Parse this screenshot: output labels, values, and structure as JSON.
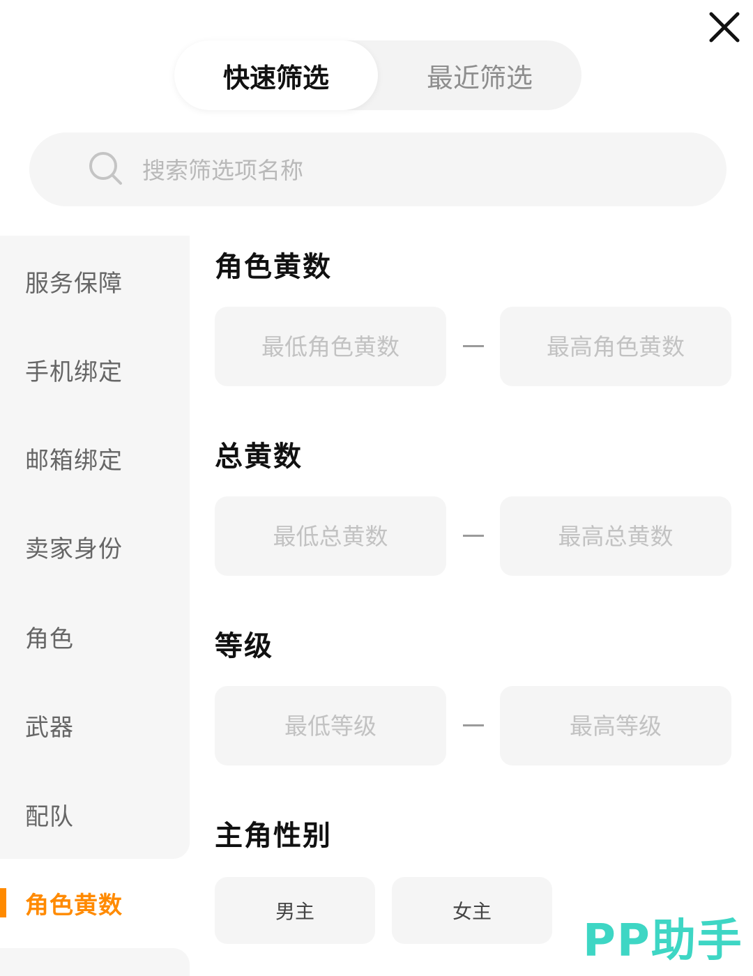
{
  "tabs": {
    "quick": "快速筛选",
    "recent": "最近筛选"
  },
  "search": {
    "placeholder": "搜索筛选项名称"
  },
  "sidebar": {
    "items": [
      {
        "label": "服务保障"
      },
      {
        "label": "手机绑定"
      },
      {
        "label": "邮箱绑定"
      },
      {
        "label": "卖家身份"
      },
      {
        "label": "角色"
      },
      {
        "label": "武器"
      },
      {
        "label": "配队"
      },
      {
        "label": "角色黄数"
      }
    ],
    "active_index": 7
  },
  "sections": {
    "role_yellow": {
      "title": "角色黄数",
      "min_placeholder": "最低角色黄数",
      "max_placeholder": "最高角色黄数"
    },
    "total_yellow": {
      "title": "总黄数",
      "min_placeholder": "最低总黄数",
      "max_placeholder": "最高总黄数"
    },
    "level": {
      "title": "等级",
      "min_placeholder": "最低等级",
      "max_placeholder": "最高等级"
    },
    "gender": {
      "title": "主角性别",
      "options": [
        "男主",
        "女主"
      ]
    }
  },
  "watermark": "PP助手",
  "colors": {
    "accent": "#ff8a00",
    "watermark": "#3ed6c4"
  }
}
